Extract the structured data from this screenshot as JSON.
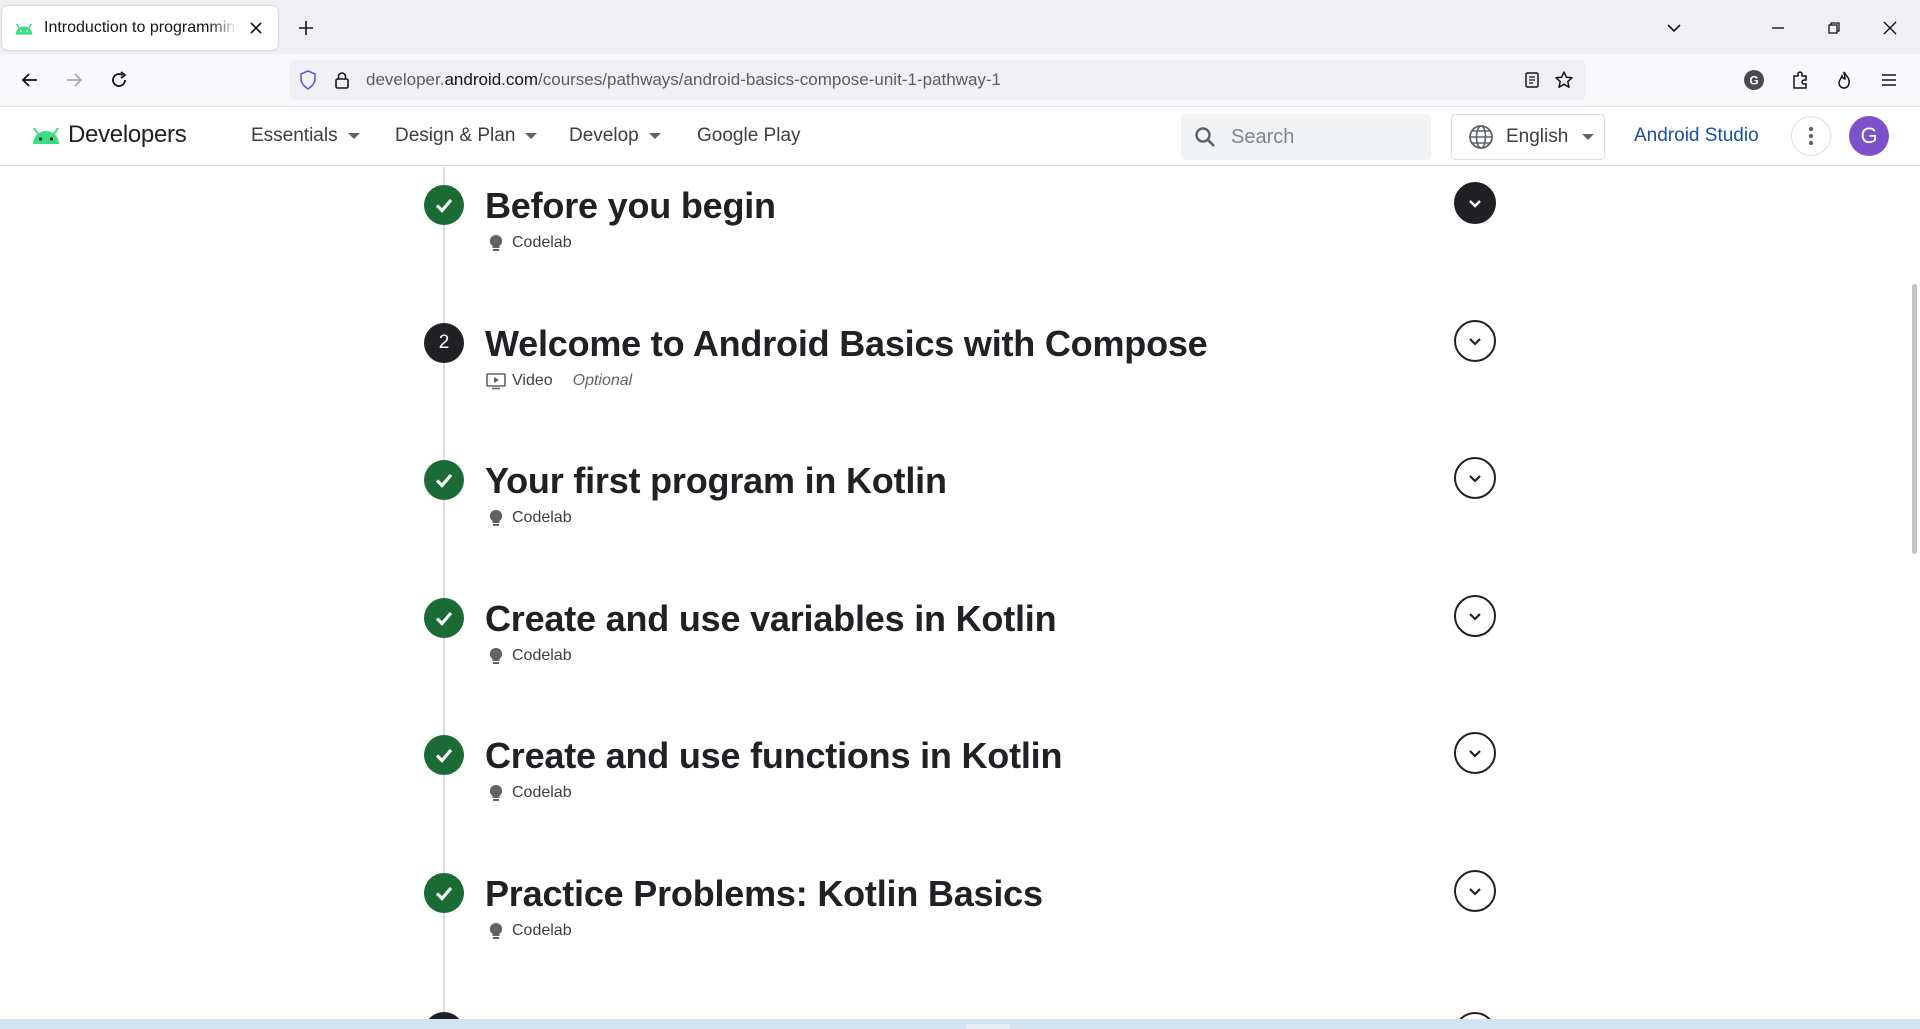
{
  "browser": {
    "tab_title": "Introduction to programming in Kotlin",
    "url_prefix": "developer.",
    "url_host": "android.com",
    "url_path": "/courses/pathways/android-basics-compose-unit-1-pathway-1"
  },
  "site": {
    "logo_text": "Developers",
    "menu": [
      {
        "label": "Essentials"
      },
      {
        "label": "Design & Plan"
      },
      {
        "label": "Develop"
      },
      {
        "label": "Google Play"
      }
    ],
    "search_placeholder": "Search",
    "language": "English",
    "android_studio": "Android Studio",
    "avatar_initial": "G"
  },
  "steps": [
    {
      "status": "done",
      "title": "Before you begin",
      "type": "Codelab",
      "type_icon": "lightbulb-icon",
      "optional": "",
      "expanded": true
    },
    {
      "status": "number",
      "number": "2",
      "title": "Welcome to Android Basics with Compose",
      "type": "Video",
      "type_icon": "video-icon",
      "optional": "Optional",
      "expanded": false
    },
    {
      "status": "done",
      "title": "Your first program in Kotlin",
      "type": "Codelab",
      "type_icon": "lightbulb-icon",
      "optional": "",
      "expanded": false
    },
    {
      "status": "done",
      "title": "Create and use variables in Kotlin",
      "type": "Codelab",
      "type_icon": "lightbulb-icon",
      "optional": "",
      "expanded": false
    },
    {
      "status": "done",
      "title": "Create and use functions in Kotlin",
      "type": "Codelab",
      "type_icon": "lightbulb-icon",
      "optional": "",
      "expanded": false
    },
    {
      "status": "done",
      "title": "Practice Problems: Kotlin Basics",
      "type": "Codelab",
      "type_icon": "lightbulb-icon",
      "optional": "",
      "expanded": false
    }
  ],
  "colors": {
    "done_green": "#1a6b36",
    "link_blue": "#1a4fa3",
    "avatar_purple": "#7b52c9"
  }
}
